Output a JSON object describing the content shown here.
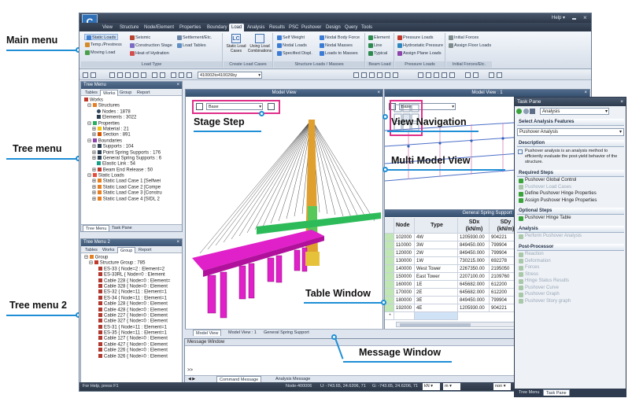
{
  "callouts": {
    "main_menu": "Main menu",
    "tree_menu": "Tree menu",
    "tree_menu_2": "Tree menu 2",
    "stage_step": "Stage Step",
    "view_navigation": "View Navigation",
    "multi_model_view": "Multi Model View",
    "table_window": "Table Window",
    "message_window": "Message Window"
  },
  "window": {
    "help": "Help"
  },
  "menu_tabs": [
    "View",
    "Structure",
    "Node/Element",
    "Properties",
    "Boundary",
    "Load",
    "Analysis",
    "Results",
    "PSC",
    "Pushover",
    "Design",
    "Query",
    "Tools"
  ],
  "active_tab": "Load",
  "ribbon": {
    "groups": [
      {
        "caption": "Load Type",
        "items": [
          "Static Loads",
          "Temp./Prestress",
          "Moving Load",
          "Seismic",
          "Construction Stage",
          "Heat of Hydration",
          "Settlement/Etc.",
          "Load Tables"
        ]
      },
      {
        "caption": "Create Load Cases",
        "items": [
          "Static Load Cases",
          "Using Load Combinations"
        ]
      },
      {
        "caption": "Structure Loads / Masses",
        "items": [
          "Self Weight",
          "Nodal Loads",
          "Specified Displ.",
          "Nodal Body Force",
          "Nodal Masses",
          "Loads to Masses"
        ]
      },
      {
        "caption": "Beam Load",
        "items": [
          "Element",
          "Line",
          "Typical"
        ]
      },
      {
        "caption": "Pressure Loads",
        "items": [
          "Pressure Loads",
          "Hydrostatic Pressure",
          "Assign Plane Loads"
        ]
      },
      {
        "caption": "Initial Forces/Etc.",
        "items": [
          "Initial Forces",
          "Assign Floor Loads"
        ]
      }
    ]
  },
  "toolbar": {
    "combo": "410002to410026by"
  },
  "tree_menu": {
    "title": "Tree Menu",
    "tabs": [
      "Tables",
      "Works",
      "Group",
      "Report"
    ],
    "active_tab": "Works",
    "items": [
      "Works",
      "Structures",
      "Nodes : 1878",
      "Elements : 3022",
      "Properties",
      "Material : 21",
      "Section : 891",
      "Boundaries",
      "Supports : 104",
      "Point Spring Supports : 176",
      "General Spring Supports : 6",
      "Elastic Link : 54",
      "Beam End Release : 50",
      "Static Loads",
      "Static Load Case 1 [Selfwei",
      "Static Load Case 2 [Compe",
      "Static Load Case 3 [Constru",
      "Static Load Case 4 [SIDL 2"
    ],
    "bottom_tabs": [
      "Tree Menu",
      "Task Pane"
    ]
  },
  "tree_menu_2": {
    "title": "Tree Menu 2",
    "tabs": [
      "Tables",
      "Works",
      "Group",
      "Report"
    ],
    "active_tab": "Group",
    "items": [
      "Group",
      "Structure Group : 785",
      "ES-33 { Node=2 : Element=2",
      "ES-33RL { Node=0 : Element",
      "Cable 228 { Node=0 : Element=",
      "Cable 328 { Node=0 : Element",
      "ES-32 { Node=11 : Element=1",
      "ES-34 { Node=11 : Element=1",
      "Cable 128 { Node=0 : Element",
      "Cable 428 { Node=0 : Element",
      "Cable 227 { Node=0 : Element",
      "Cable 327 { Node=0 : Element",
      "ES-31 { Node=11 : Element=1",
      "ES-35 { Node=11 : Element=1",
      "Cable 127 { Node=0 : Element",
      "Cable 427 { Node=0 : Element",
      "Cable 226 { Node=0 : Element",
      "Cable 326 { Node=0 : Element"
    ]
  },
  "model_view": {
    "title": "Model View",
    "stage": "Base"
  },
  "model_view_1": {
    "title": "Model View : 1",
    "stage": "Base"
  },
  "table": {
    "title": "General Spring Support",
    "headers": [
      "Node",
      "Type",
      "SDx (kN/m)",
      "SDy (kN/m)"
    ],
    "rows": [
      [
        "102000",
        "4W",
        "1205930.00",
        "904221"
      ],
      [
        "110000",
        "3W",
        "849450.000",
        "799904"
      ],
      [
        "120000",
        "2W",
        "849450.000",
        "799904"
      ],
      [
        "130000",
        "1W",
        "730215.000",
        "692278"
      ],
      [
        "140000",
        "West Tower",
        "2267350.00",
        "2195050"
      ],
      [
        "150000",
        "East Tower",
        "2207100.00",
        "2109760"
      ],
      [
        "160000",
        "1E",
        "645682.000",
        "612200"
      ],
      [
        "170000",
        "2E",
        "645682.000",
        "612200"
      ],
      [
        "180000",
        "3E",
        "849450.000",
        "799904"
      ],
      [
        "192000",
        "4E",
        "1205930.00",
        "904221"
      ]
    ]
  },
  "view_tabs": [
    "Model View",
    "Model View : 1",
    "General Spring Support"
  ],
  "message_window": {
    "title": "Message Window",
    "prompt": ">>",
    "tabs": [
      "Command Message",
      "Analysis Message"
    ]
  },
  "status_bar": {
    "help": "For Help, press F1",
    "node": "Node-400006",
    "u": "U: -743.65, 24.6206, 71",
    "g": "G: -743.65, 24.6206, 71",
    "unit1": "kN",
    "unit2": "m",
    "mode": "non"
  },
  "task_pane": {
    "title": "Task Pane",
    "mode": "Analysis",
    "features_label": "Select Analysis Features",
    "feature": "Pushover Analysis",
    "description_label": "Description",
    "description": "Pushover analysis is an analysis method to efficiently evaluate the post-yield behavior of the structure.",
    "required_label": "Required Steps",
    "required": [
      {
        "label": "Pushover Global Control",
        "enabled": true
      },
      {
        "label": "Pushover Load Cases",
        "enabled": false
      },
      {
        "label": "Define Pushover Hinge Properties",
        "enabled": true
      },
      {
        "label": "Assign Pushover Hinge Properties",
        "enabled": true
      }
    ],
    "optional_label": "Optional Steps",
    "optional": [
      {
        "label": "Pushover Hinge Table",
        "enabled": true
      }
    ],
    "analysis_label": "Analysis",
    "analysis": [
      {
        "label": "Perform Pushover Analysis",
        "enabled": false
      }
    ],
    "post_label": "Post-Processor",
    "post": [
      {
        "label": "Reaction",
        "enabled": false
      },
      {
        "label": "Deformation",
        "enabled": false
      },
      {
        "label": "Forces",
        "enabled": false
      },
      {
        "label": "Stress",
        "enabled": false
      },
      {
        "label": "Hinge Status Results",
        "enabled": false
      },
      {
        "label": "Pushover Curve",
        "enabled": false
      },
      {
        "label": "Pushover Graph",
        "enabled": false
      },
      {
        "label": "Pushover Story graph",
        "enabled": false
      }
    ],
    "bottom_tabs": [
      "Tree Menu",
      "Task Pane"
    ],
    "active_bottom_tab": "Task Pane"
  },
  "colors": {
    "accent": "#1f8fd6",
    "highlight": "#e0308a",
    "deck": "#e020c8",
    "grid_header": "#e7ecf3",
    "row_green": "#bfe6b3"
  }
}
